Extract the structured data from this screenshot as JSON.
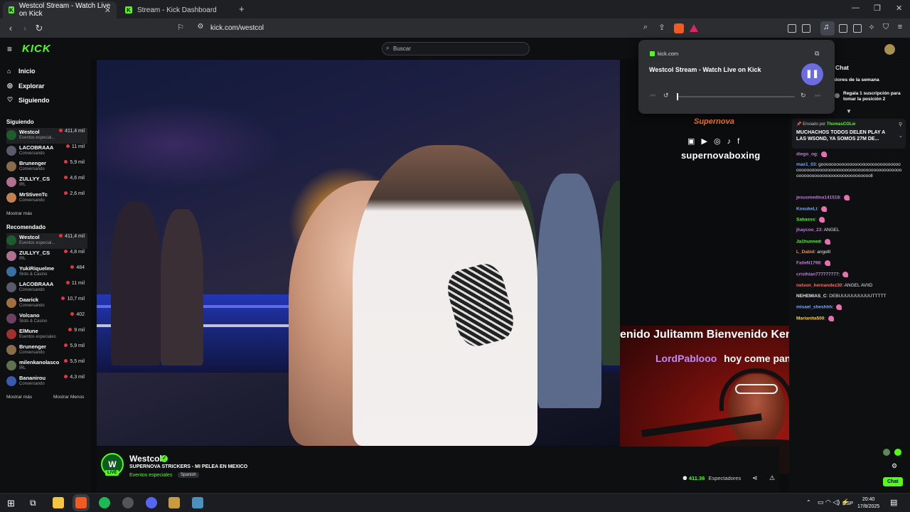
{
  "browser": {
    "tabs": [
      {
        "label": "Westcol Stream - Watch Live on Kick",
        "active": true
      },
      {
        "label": "Stream - Kick Dashboard",
        "active": false
      }
    ],
    "new_tab": "+",
    "url": "kick.com/westcol"
  },
  "kick": {
    "logo": "KICK",
    "search_placeholder": "Buscar"
  },
  "sidebar": {
    "nav": [
      "Inicio",
      "Explorar",
      "Siguiendo"
    ],
    "following_title": "Siguiendo",
    "following": [
      {
        "name": "Westcol",
        "category": "Eventos especial...",
        "viewers": "411,4 mil",
        "color": "#1d5c2c"
      },
      {
        "name": "LACOBRAAA",
        "category": "Conversando",
        "viewers": "11 mil",
        "color": "#5a5a6a"
      },
      {
        "name": "Brunenger",
        "category": "Conversando",
        "viewers": "5,9 mil",
        "color": "#8a6b4a"
      },
      {
        "name": "ZULLYY_CS",
        "category": "IRL",
        "viewers": "4,6 mil",
        "color": "#b07090"
      },
      {
        "name": "MrStivenTc",
        "category": "Conversando",
        "viewers": "2,6 mil",
        "color": "#c08050"
      }
    ],
    "following_more": "Mostrar más",
    "recommended_title": "Recomendado",
    "recommended": [
      {
        "name": "Westcol",
        "category": "Eventos especial...",
        "viewers": "411,4 mil",
        "color": "#1d5c2c"
      },
      {
        "name": "ZULLYY_CS",
        "category": "IRL",
        "viewers": "4,8 mil",
        "color": "#b07090"
      },
      {
        "name": "YukiRiquelme",
        "category": "Slots & Casino",
        "viewers": "484",
        "color": "#3a70a0"
      },
      {
        "name": "LACOBRAAA",
        "category": "Conversando",
        "viewers": "11 mil",
        "color": "#5a5a6a"
      },
      {
        "name": "Daarick",
        "category": "Conversando",
        "viewers": "10,7 mil",
        "color": "#a07040"
      },
      {
        "name": "Volcano",
        "category": "Slots & Casino",
        "viewers": "402",
        "color": "#704060"
      },
      {
        "name": "ElMune",
        "category": "Eventos especiales",
        "viewers": "9 mil",
        "color": "#a03030"
      },
      {
        "name": "Brunenger",
        "category": "Conversando",
        "viewers": "5,9 mil",
        "color": "#8a6b4a"
      },
      {
        "name": "milenkanolasco",
        "category": "IRL",
        "viewers": "5,5 mil",
        "color": "#607050"
      },
      {
        "name": "Bananirou",
        "category": "Conversando",
        "viewers": "4,3 mil",
        "color": "#3a5ab0"
      }
    ],
    "rec_more": "Mostrar más",
    "rec_less": "Mostrar Menos"
  },
  "video": {
    "brand": "supernovaboxing",
    "logo_text": "Supernova",
    "social": "▣ ▶ ◎ ♪ f"
  },
  "facecam": {
    "ticker": "enido Julitamm    Bienvenido Ken",
    "user": "LordPablooo",
    "message": "hoy come pancho"
  },
  "stream": {
    "streamer": "Westcol",
    "live": "LIVE",
    "title": "SUPERNOVA STRICKERS - MI PELEA EN MEXICO",
    "category": "Eventos especiales",
    "language": "Spanish",
    "viewers": "411.36",
    "viewers_unit": "Espectadores"
  },
  "media_popup": {
    "site": "kick.com",
    "title": "Westcol Stream - Watch Live on Kick"
  },
  "chat": {
    "header": "Chat",
    "leaderboard": "galadores de la semana",
    "gift_line1": "Regala 1 suscripción para",
    "gift_line2": "tomar la posición 2",
    "pinned_by": "Enviado por",
    "pinned_user": "ThomasCOLw",
    "pinned_msg": "MUCHACHOS TODOS DELEN PLAY A LAS WSOND, YA SOMOS 27M DE...",
    "messages": [
      {
        "user": "diego_og",
        "color": "#c07ad8",
        "text": ""
      },
      {
        "user": "max1_03",
        "color": "#7aa7ff",
        "text": "goooooooooooooooooooooooooooooooooooooooooooooooooooooooooooooooooooooooooooooooooooooooooooooooooooooll"
      },
      {
        "user": "jesusmedina141518",
        "color": "#c07ad8",
        "text": ""
      },
      {
        "user": "KosukeLi",
        "color": "#7aa7ff",
        "text": ""
      },
      {
        "user": "Sabasss",
        "color": "#53fc18",
        "text": ""
      },
      {
        "user": "jhaycoo_23",
        "color": "#c07ad8",
        "text": "ANGEL"
      },
      {
        "user": "Ja1hunned",
        "color": "#53fc18",
        "text": ""
      },
      {
        "user": "L_Dabid",
        "color": "#ff8a3a",
        "text": "angelll"
      },
      {
        "user": "FaileN1798",
        "color": "#c07ad8",
        "text": ""
      },
      {
        "user": "cristhian777777777",
        "color": "#c07ad8",
        "text": ""
      },
      {
        "user": "nelson_hernandez30",
        "color": "#ff6b6b",
        "text": "ANGEL AVIID"
      },
      {
        "user": "NEHEMIAS_C",
        "color": "#e6e6e6",
        "text": "DEBUUUUUUUUUUTTTTT"
      },
      {
        "user": "misael_sheshhh",
        "color": "#7aa7ff",
        "text": ""
      },
      {
        "user": "Marianita500",
        "color": "#ffd34a",
        "text": ""
      }
    ],
    "chat_button": "Chat"
  },
  "taskbar": {
    "lang": "ESP",
    "time": "20:40",
    "date": "17/8/2025"
  }
}
